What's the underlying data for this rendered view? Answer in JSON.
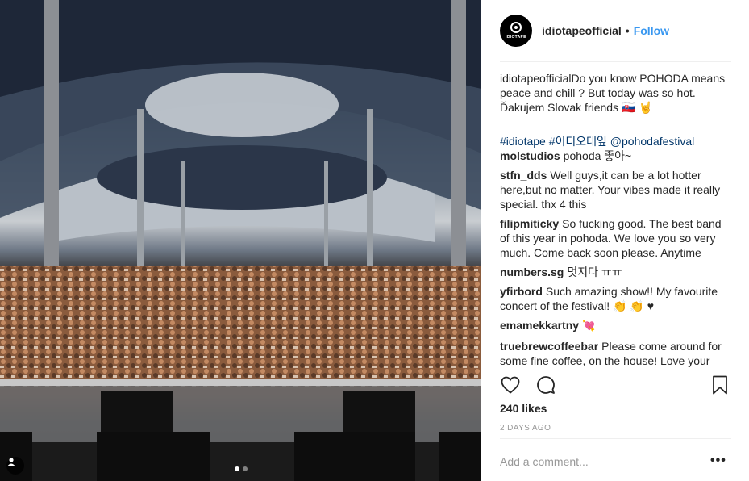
{
  "post": {
    "account": "idiotape",
    "username": "idiotapeofficial",
    "separator": "•",
    "follow_label": "Follow",
    "avatar_text": "IDIOTAPE",
    "caption": {
      "username": "idiotapeofficial",
      "text": "Do you know POHODA means peace and chill ? But today was so hot. Ďakujem Slovak friends 🇸🇰 🤘",
      "hashtags": "#idiotape #이디오테잎 @pohodafestival"
    },
    "comments": [
      {
        "user": "molstudios",
        "text": "pohoda 좋아~"
      },
      {
        "user": "stfn_dds",
        "text": "Well guys,it can be a lot hotter here,but no matter. Your vibes made it really special. thx 4 this"
      },
      {
        "user": "filipmiticky",
        "text": "So fucking good. The best band of this year in pohoda. We love you so very much. Come back soon please. Anytime"
      },
      {
        "user": "numbers.sg",
        "text": "멋지다 ㅠㅠ"
      },
      {
        "user": "yfirbord",
        "text": "Such amazing show!! My favourite concert of the festival! 👏 👏 ♥"
      },
      {
        "user": "emamekkartny",
        "text": "💘"
      },
      {
        "user": "truebrewcoffeebar",
        "text": "Please come around for some fine coffee, on the house! Love your"
      }
    ],
    "likes": "240 likes",
    "time": "2 DAYS AGO",
    "add_comment_placeholder": "Add a comment...",
    "more_label": "•••",
    "carousel": {
      "count": 2,
      "active": 1
    },
    "icons": [
      "heart-icon",
      "comment-icon",
      "bookmark-icon",
      "user-tag-icon"
    ],
    "colors": {
      "link": "#3897f0",
      "hashtag": "#003569",
      "text": "#262626",
      "muted": "#999999"
    }
  }
}
